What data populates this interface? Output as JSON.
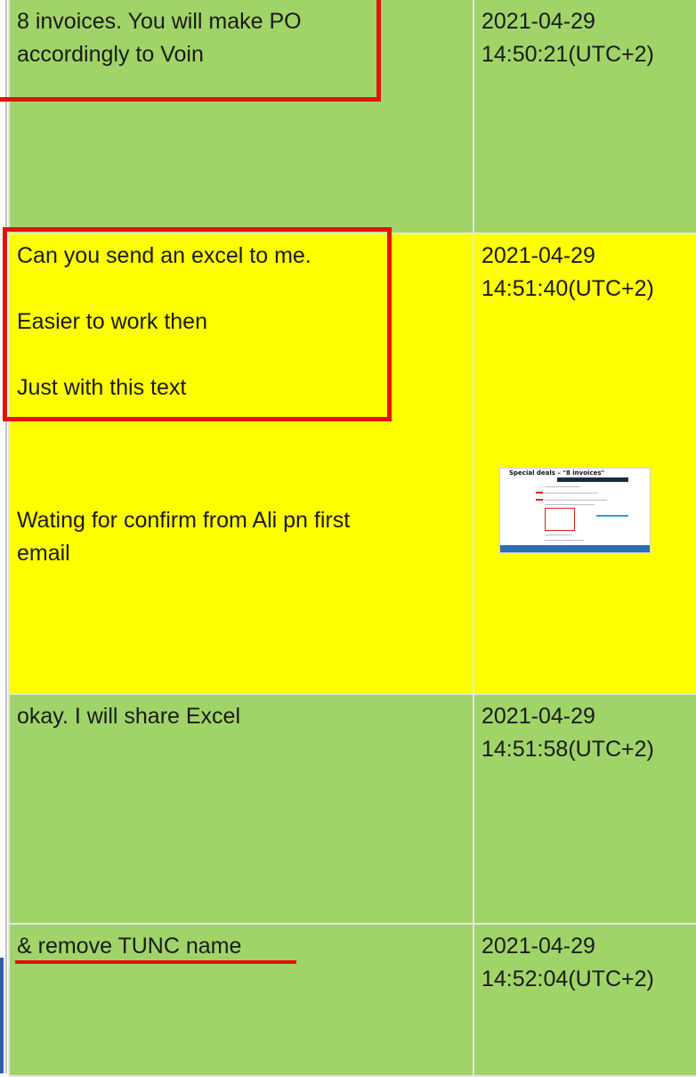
{
  "rows": [
    {
      "lines": [
        "8 invoices. You will make PO",
        "accordingly to Voin"
      ],
      "date": "2021-04-29",
      "time": "14:50:21(UTC+2)"
    },
    {
      "lines": [
        "Can you send an excel to me.",
        "Easier to work then",
        "Just with this text",
        "Wating for confirm from Ali pn first",
        "email"
      ],
      "date": "2021-04-29",
      "time": "14:51:40(UTC+2)",
      "thumbnail_title": "Special deals – \"8 invoices\""
    },
    {
      "lines": [
        "okay. I will share Excel"
      ],
      "date": "2021-04-29",
      "time": "14:51:58(UTC+2)"
    },
    {
      "lines": [
        "& remove TUNC name"
      ],
      "date": "2021-04-29",
      "time": "14:52:04(UTC+2)"
    }
  ],
  "colors": {
    "green_row": "#a0d468",
    "yellow_row": "#ffff00",
    "highlight_red": "#e3120b",
    "left_blue_bar": "#2f5fb0"
  }
}
